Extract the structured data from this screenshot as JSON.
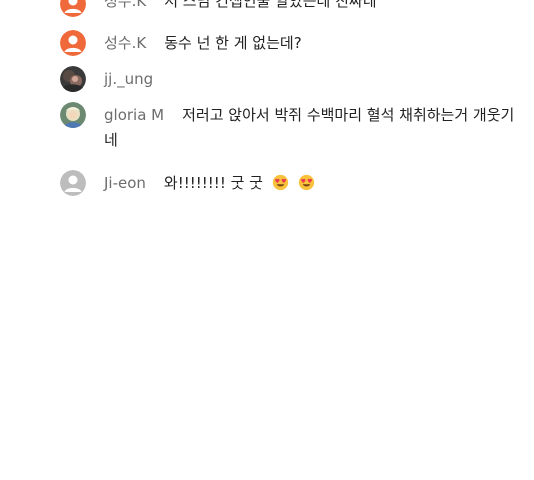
{
  "comments": [
    {
      "username": "성수.K",
      "text": "저 스님 컨셉인줄 알았는데 진짜네",
      "avatar": "default-orange-avatar"
    },
    {
      "username": "성수.K",
      "text": "동수 넌 한 게 없는데?",
      "avatar": "default-orange-avatar"
    },
    {
      "username": "jj._ung",
      "text": "",
      "avatar": "photo-avatar"
    },
    {
      "username": "gloria M",
      "text": "저러고 앉아서 박쥐 수백마리 혈석 채취하는거 개웃기네",
      "avatar": "photo-avatar"
    },
    {
      "username": "Ji-eon",
      "text": "와!!!!!!!! 굿 굿",
      "emoji": [
        "heart-eyes-emoji",
        "heart-eyes-emoji"
      ],
      "avatar": "default-gray-avatar"
    }
  ],
  "colors": {
    "orange_avatar": "#f0693a",
    "gray_avatar": "#bdbdbd",
    "username": "#6d6d6d",
    "text": "#222222"
  }
}
